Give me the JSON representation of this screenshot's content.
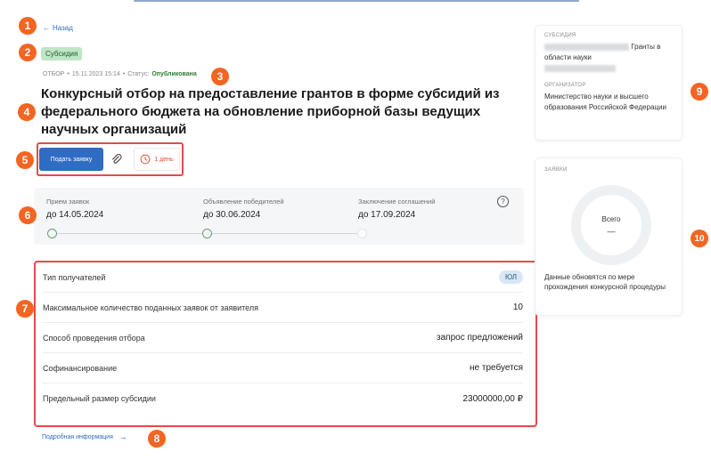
{
  "nav": {
    "back_label": "Назад"
  },
  "badge": {
    "label": "Субсидия"
  },
  "meta": {
    "selection_label": "ОТБОР",
    "date": "15.11.2023 15:14",
    "status_label": "Статус:",
    "status_value": "Опубликована"
  },
  "title": "Конкурсный отбор на предоставление грантов в форме субсидий из федерального бюджета на обновление приборной базы ведущих научных организаций",
  "actions": {
    "submit_label": "Подать заявку",
    "link_icon": "paperclip-icon",
    "deadline_icon": "clock-icon",
    "deadline_label": "1 день"
  },
  "stages": [
    {
      "label": "Прием заявок",
      "value": "до 14.05.2024"
    },
    {
      "label": "Объявление победителей",
      "value": "до 30.06.2024"
    },
    {
      "label": "Заключение соглашений",
      "value": "до 17.09.2024"
    }
  ],
  "params": [
    {
      "name": "Тип получателей",
      "value": "ЮЛ"
    },
    {
      "name": "Максимальное количество поданных заявок от заявителя",
      "value": "10"
    },
    {
      "name": "Способ проведения отбора",
      "value": "запрос предложений"
    },
    {
      "name": "Софинансирование",
      "value": "не требуется"
    },
    {
      "name": "Предельный размер субсидии",
      "value": "23000000,00 ₽"
    }
  ],
  "more_link": "Подробная информация",
  "subsidy_card": {
    "caption": "СУБСИДИЯ",
    "text_1": "Гранты в",
    "text_2": "области науки",
    "organizer_caption": "ОРГАНИЗАТОР",
    "organizer": "Министерство науки и высшего образования Российской Федерации"
  },
  "applications_card": {
    "caption": "ЗАЯВКИ",
    "total_label": "Всего",
    "total_value": "—",
    "note": "Данные обновятся по мере прохождения конкурсной процедуры"
  },
  "markers": [
    "1",
    "2",
    "3",
    "4",
    "5",
    "6",
    "7",
    "8",
    "9",
    "10"
  ],
  "colors": {
    "accent": "#2f6cc4",
    "marker": "#f26522",
    "highlight": "#e8484a",
    "badge": "#bfe6c5"
  }
}
